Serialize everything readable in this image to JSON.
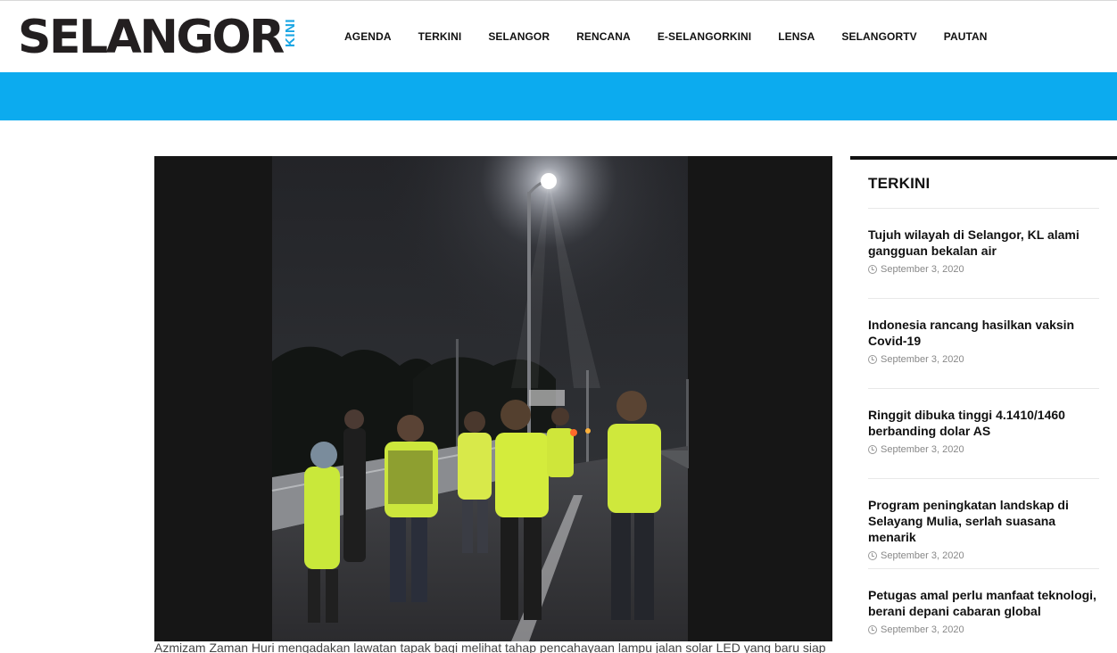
{
  "brand": {
    "logo_main": "SELANGOR",
    "logo_sub": "KINI",
    "accent_color": "#0cabef",
    "kini_color": "#1aa6e4"
  },
  "nav": {
    "items": [
      "AGENDA",
      "TERKINI",
      "SELANGOR",
      "RENCANA",
      "E-SELANGORKINI",
      "LENSA",
      "SELANGORTV",
      "PAUTAN"
    ]
  },
  "article": {
    "photo_icon": "night-road-photo",
    "caption": "Azmizam Zaman Huri mengadakan lawatan tapak bagi melihat tahap pencahayaan lampu jalan solar LED yang baru siap"
  },
  "sidebar": {
    "title": "TERKINI",
    "items": [
      {
        "title": "Tujuh wilayah di Selangor, KL alami gangguan bekalan air",
        "date": "September 3, 2020"
      },
      {
        "title": "Indonesia rancang hasilkan vaksin Covid-19",
        "date": "September 3, 2020"
      },
      {
        "title": "Ringgit dibuka tinggi 4.1410/1460 berbanding dolar AS",
        "date": "September 3, 2020"
      },
      {
        "title": "Program peningkatan landskap di Selayang Mulia, serlah suasana menarik",
        "date": "September 3, 2020"
      },
      {
        "title": "Petugas amal perlu manfaat teknologi, berani depani cabaran global",
        "date": "September 3, 2020"
      }
    ]
  }
}
